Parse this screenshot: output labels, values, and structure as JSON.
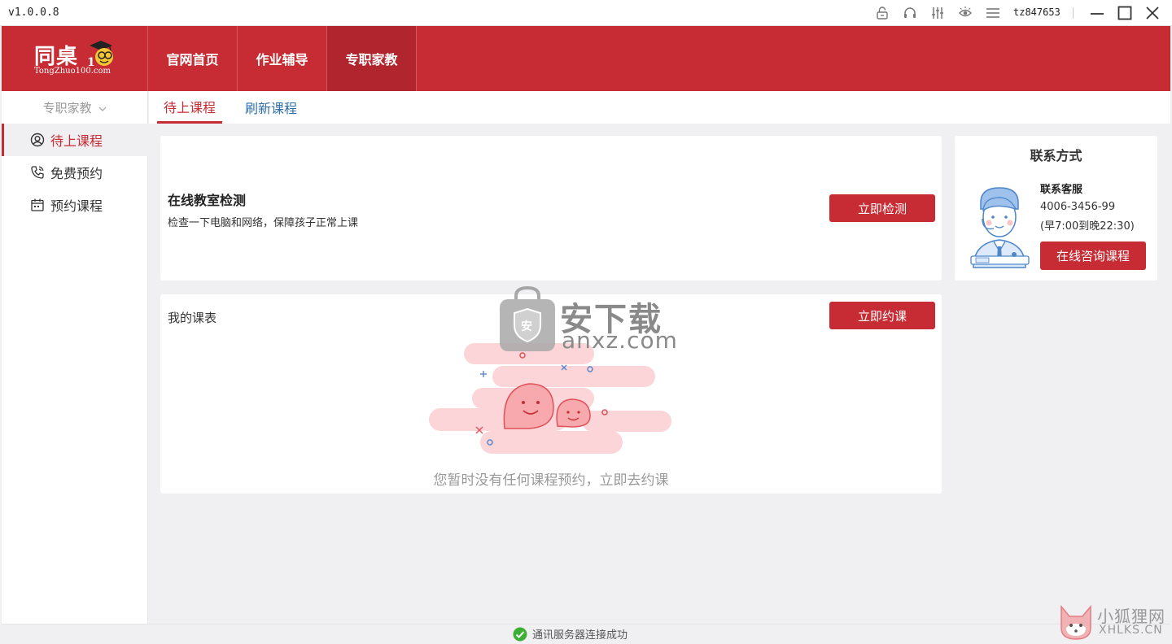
{
  "titlebar": {
    "version": "v1.0.0.8",
    "username": "tz847653",
    "icons": [
      "lock-icon",
      "headset-icon",
      "settings-sliders-icon",
      "eye-protect-icon",
      "menu-icon"
    ],
    "window_controls": [
      "minimize-icon",
      "maximize-icon",
      "close-icon"
    ]
  },
  "logo": {
    "cn": "同桌",
    "en": "TongZhuo100.com"
  },
  "nav": {
    "items": [
      {
        "label": "官网首页",
        "active": false
      },
      {
        "label": "作业辅导",
        "active": false
      },
      {
        "label": "专职家教",
        "active": true
      }
    ]
  },
  "sidebar": {
    "header": "专职家教",
    "items": [
      {
        "label": "待上课程",
        "icon": "user-circle-icon",
        "active": true
      },
      {
        "label": "免费预约",
        "icon": "phone-icon",
        "active": false
      },
      {
        "label": "预约课程",
        "icon": "calendar-icon",
        "active": false
      }
    ]
  },
  "tabs": {
    "items": [
      {
        "label": "待上课程",
        "active": true
      },
      {
        "label": "刷新课程",
        "active": false
      }
    ]
  },
  "check_card": {
    "title": "在线教室检测",
    "desc": "检查一下电脑和网络，保障孩子正常上课",
    "button": "立即检测"
  },
  "schedule_card": {
    "title": "我的课表",
    "button": "立即约课",
    "empty_text": "您暂时没有任何课程预约，立即去约课"
  },
  "contact_card": {
    "title": "联系方式",
    "name": "联系客服",
    "phone": "4006-3456-99",
    "hours": "(早7:00到晚22:30)",
    "button": "在线咨询课程",
    "badge": "客服"
  },
  "status": {
    "text": "通讯服务器连接成功",
    "color": "#3cb034"
  },
  "watermarks": {
    "anxz_cn": "安下载",
    "anxz_en": "anxz.com",
    "xhlks_cn": "小狐狸网",
    "xhlks_en": "XHLKS.CN"
  },
  "colors": {
    "brand": "#c72b33",
    "link": "#2f6fa8",
    "background": "#f0eff2"
  }
}
